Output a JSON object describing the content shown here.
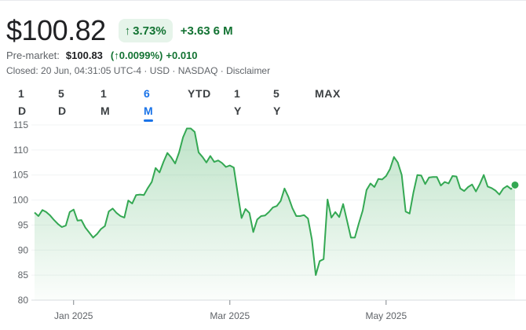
{
  "quote": {
    "price": "$100.82",
    "pct_change": "3.73%",
    "abs_change": "+3.63",
    "period": "6 M",
    "premarket_label": "Pre-market:",
    "premarket_price": "$100.83",
    "premarket_pct": "(↑0.0099%)",
    "premarket_abs": "+0.010",
    "closed_info": "Closed: 20 Jun, 04:31:05 UTC-4 · USD · NASDAQ · Disclaimer"
  },
  "tabs": [
    "1 D",
    "5 D",
    "1 M",
    "6 M",
    "YTD",
    "1 Y",
    "5 Y",
    "MAX"
  ],
  "active_tab": "6 M",
  "colors": {
    "up": "#137333",
    "line": "#34a853",
    "accent": "#1a73e8"
  },
  "chart_data": {
    "type": "area",
    "ylim": [
      80,
      115
    ],
    "yticks": [
      80,
      85,
      90,
      95,
      100,
      105,
      110,
      115
    ],
    "xtick_labels": [
      {
        "label": "Jan 2025",
        "x": 10
      },
      {
        "label": "Mar 2025",
        "x": 50
      },
      {
        "label": "May 2025",
        "x": 90
      }
    ],
    "x_range": [
      0,
      123
    ],
    "values": [
      97.5,
      96.8,
      98.0,
      97.6,
      96.9,
      96.0,
      95.2,
      94.6,
      94.9,
      97.6,
      98.1,
      95.9,
      96.0,
      94.5,
      93.5,
      92.5,
      93.2,
      94.2,
      94.8,
      97.7,
      98.3,
      97.4,
      96.8,
      96.5,
      99.9,
      99.3,
      101.0,
      101.1,
      101.0,
      102.4,
      103.6,
      106.4,
      105.5,
      107.6,
      109.4,
      108.5,
      107.3,
      109.5,
      112.5,
      114.3,
      114.3,
      113.6,
      109.5,
      108.6,
      107.5,
      108.8,
      107.6,
      107.9,
      107.4,
      106.6,
      106.9,
      106.5,
      101.4,
      96.4,
      98.2,
      97.4,
      93.6,
      96.1,
      96.8,
      96.9,
      97.6,
      98.5,
      98.8,
      99.8,
      102.3,
      100.6,
      98.4,
      96.8,
      96.8,
      97.0,
      96.3,
      92.1,
      85.0,
      87.8,
      88.2,
      100.1,
      96.5,
      97.6,
      96.6,
      99.2,
      95.9,
      92.5,
      92.5,
      95.3,
      97.9,
      102.0,
      103.3,
      102.6,
      104.2,
      104.1,
      104.8,
      106.2,
      108.6,
      107.5,
      105.0,
      97.7,
      97.3,
      101.5,
      105.0,
      104.9,
      103.2,
      104.5,
      104.6,
      104.6,
      102.9,
      103.6,
      103.3,
      104.8,
      104.7,
      102.3,
      101.8,
      102.6,
      103.1,
      101.7,
      103.2,
      105.0,
      102.7,
      102.4,
      101.9,
      101.1,
      102.3,
      102.8,
      102.2,
      103.0
    ]
  }
}
